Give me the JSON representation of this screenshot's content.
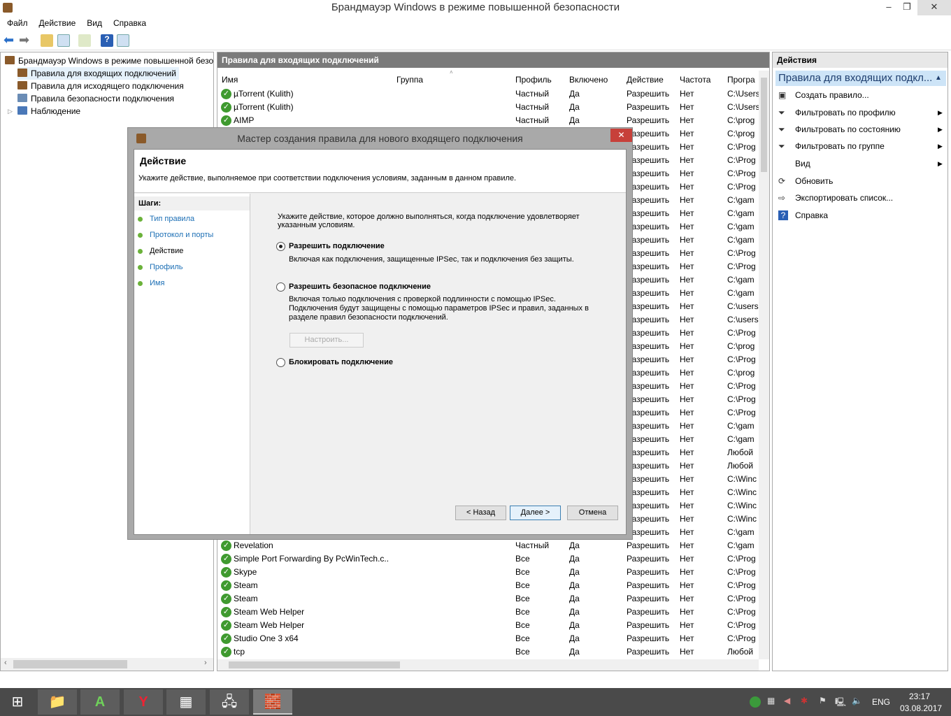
{
  "window": {
    "title": "Брандмауэр Windows в режиме повышенной безопасности",
    "minimize": "‒",
    "restore": "❐",
    "close": "✕"
  },
  "menu": [
    "Файл",
    "Действие",
    "Вид",
    "Справка"
  ],
  "tree": [
    "Брандмауэр Windows в режиме повышенной безопасности на",
    "Правила для входящих подключений",
    "Правила для исходящего подключения",
    "Правила безопасности подключения",
    "Наблюдение"
  ],
  "center": {
    "title": "Правила для входящих подключений",
    "columns": [
      "Имя",
      "Группа",
      "Профиль",
      "Включено",
      "Действие",
      "Частота",
      "Програ"
    ],
    "rows": [
      [
        "µTorrent (Kulith)",
        "",
        "Частный",
        "Да",
        "Разрешить",
        "Нет",
        "C:\\Users"
      ],
      [
        "µTorrent (Kulith)",
        "",
        "Частный",
        "Да",
        "Разрешить",
        "Нет",
        "C:\\Users"
      ],
      [
        "AIMP",
        "",
        "Частный",
        "Да",
        "Разрешить",
        "Нет",
        "C:\\prog"
      ],
      [
        "",
        "",
        "",
        "",
        "Разрешить",
        "Нет",
        "C:\\prog"
      ],
      [
        "",
        "",
        "",
        "",
        "Разрешить",
        "Нет",
        "C:\\Prog"
      ],
      [
        "",
        "",
        "",
        "",
        "Разрешить",
        "Нет",
        "C:\\Prog"
      ],
      [
        "",
        "",
        "",
        "",
        "Разрешить",
        "Нет",
        "C:\\Prog"
      ],
      [
        "",
        "",
        "",
        "",
        "Разрешить",
        "Нет",
        "C:\\Prog"
      ],
      [
        "",
        "",
        "",
        "",
        "Разрешить",
        "Нет",
        "C:\\gam"
      ],
      [
        "",
        "",
        "",
        "",
        "Разрешить",
        "Нет",
        "C:\\gam"
      ],
      [
        "",
        "",
        "",
        "",
        "Разрешить",
        "Нет",
        "C:\\gam"
      ],
      [
        "",
        "",
        "",
        "",
        "Разрешить",
        "Нет",
        "C:\\gam"
      ],
      [
        "",
        "",
        "",
        "",
        "Разрешить",
        "Нет",
        "C:\\Prog"
      ],
      [
        "",
        "",
        "",
        "",
        "Разрешить",
        "Нет",
        "C:\\Prog"
      ],
      [
        "",
        "",
        "",
        "",
        "Разрешить",
        "Нет",
        "C:\\gam"
      ],
      [
        "",
        "",
        "",
        "",
        "Разрешить",
        "Нет",
        "C:\\gam"
      ],
      [
        "",
        "",
        "",
        "",
        "Разрешить",
        "Нет",
        "C:\\users"
      ],
      [
        "",
        "",
        "",
        "",
        "Разрешить",
        "Нет",
        "C:\\users"
      ],
      [
        "",
        "",
        "",
        "",
        "Разрешить",
        "Нет",
        "C:\\Prog"
      ],
      [
        "",
        "",
        "",
        "",
        "Разрешить",
        "Нет",
        "C:\\prog"
      ],
      [
        "",
        "",
        "",
        "",
        "Разрешить",
        "Нет",
        "C:\\Prog"
      ],
      [
        "",
        "",
        "",
        "",
        "Разрешить",
        "Нет",
        "C:\\prog"
      ],
      [
        "",
        "",
        "",
        "",
        "Разрешить",
        "Нет",
        "C:\\Prog"
      ],
      [
        "",
        "",
        "",
        "",
        "Разрешить",
        "Нет",
        "C:\\Prog"
      ],
      [
        "",
        "",
        "",
        "",
        "Разрешить",
        "Нет",
        "C:\\Prog"
      ],
      [
        "",
        "",
        "",
        "",
        "Разрешить",
        "Нет",
        "C:\\gam"
      ],
      [
        "",
        "",
        "",
        "",
        "Разрешить",
        "Нет",
        "C:\\gam"
      ],
      [
        "",
        "",
        "",
        "",
        "Разрешить",
        "Нет",
        "Любой"
      ],
      [
        "",
        "",
        "",
        "",
        "Разрешить",
        "Нет",
        "Любой"
      ],
      [
        "",
        "",
        "",
        "",
        "Разрешить",
        "Нет",
        "C:\\Winc"
      ],
      [
        "",
        "",
        "",
        "",
        "Разрешить",
        "Нет",
        "C:\\Winc"
      ],
      [
        "",
        "",
        "",
        "",
        "Разрешить",
        "Нет",
        "C:\\Winc"
      ],
      [
        "",
        "",
        "",
        "",
        "Разрешить",
        "Нет",
        "C:\\Winc"
      ],
      [
        "",
        "",
        "",
        "",
        "Разрешить",
        "Нет",
        "C:\\gam"
      ],
      [
        "Revelation",
        "",
        "Частный",
        "Да",
        "Разрешить",
        "Нет",
        "C:\\gam"
      ],
      [
        "Simple Port Forwarding By PcWinTech.c...",
        "",
        "Все",
        "Да",
        "Разрешить",
        "Нет",
        "C:\\Prog"
      ],
      [
        "Skype",
        "",
        "Все",
        "Да",
        "Разрешить",
        "Нет",
        "C:\\Prog"
      ],
      [
        "Steam",
        "",
        "Все",
        "Да",
        "Разрешить",
        "Нет",
        "C:\\Prog"
      ],
      [
        "Steam",
        "",
        "Все",
        "Да",
        "Разрешить",
        "Нет",
        "C:\\Prog"
      ],
      [
        "Steam Web Helper",
        "",
        "Все",
        "Да",
        "Разрешить",
        "Нет",
        "C:\\Prog"
      ],
      [
        "Steam Web Helper",
        "",
        "Все",
        "Да",
        "Разрешить",
        "Нет",
        "C:\\Prog"
      ],
      [
        "Studio One 3 x64",
        "",
        "Все",
        "Да",
        "Разрешить",
        "Нет",
        "C:\\Prog"
      ],
      [
        "tcp",
        "",
        "Все",
        "Да",
        "Разрешить",
        "Нет",
        "Любой"
      ]
    ]
  },
  "actions": {
    "title": "Действия",
    "section": "Правила для входящих подкл...",
    "items": [
      {
        "label": "Создать правило...",
        "icon": "new-rule-icon",
        "submenu": false
      },
      {
        "label": "Фильтровать по профилю",
        "icon": "filter-icon",
        "submenu": true
      },
      {
        "label": "Фильтровать по состоянию",
        "icon": "filter-icon",
        "submenu": true
      },
      {
        "label": "Фильтровать по группе",
        "icon": "filter-icon",
        "submenu": true
      },
      {
        "label": "Вид",
        "icon": "",
        "submenu": true
      },
      {
        "label": "Обновить",
        "icon": "refresh-icon",
        "submenu": false
      },
      {
        "label": "Экспортировать список...",
        "icon": "export-icon",
        "submenu": false
      },
      {
        "label": "Справка",
        "icon": "help-icon",
        "submenu": false
      }
    ]
  },
  "dialog": {
    "title": "Мастер создания правила для нового входящего подключения",
    "heading": "Действие",
    "subheading": "Укажите действие, выполняемое при соответствии подключения условиям, заданным в данном правиле.",
    "steps_label": "Шаги:",
    "steps": [
      "Тип правила",
      "Протокол и порты",
      "Действие",
      "Профиль",
      "Имя"
    ],
    "current_step": "Действие",
    "prompt": "Укажите действие, которое должно выполняться, когда подключение удовлетворяет указанным условиям.",
    "options": [
      {
        "label": "Разрешить подключение",
        "desc": "Включая как подключения, защищенные IPSec, так и подключения без защиты.",
        "selected": true
      },
      {
        "label": "Разрешить безопасное подключение",
        "desc": "Включая только подключения с проверкой подлинности с помощью IPSec. Подключения будут защищены с помощью параметров IPSec и правил, заданных в разделе правил безопасности подключений.",
        "selected": false
      },
      {
        "label": "Блокировать подключение",
        "desc": "",
        "selected": false
      }
    ],
    "customize": "Настроить...",
    "back": "< Назад",
    "next": "Далее >",
    "cancel": "Отмена"
  },
  "taskbar": {
    "lang": "ENG",
    "time": "23:17",
    "date": "03.08.2017"
  }
}
